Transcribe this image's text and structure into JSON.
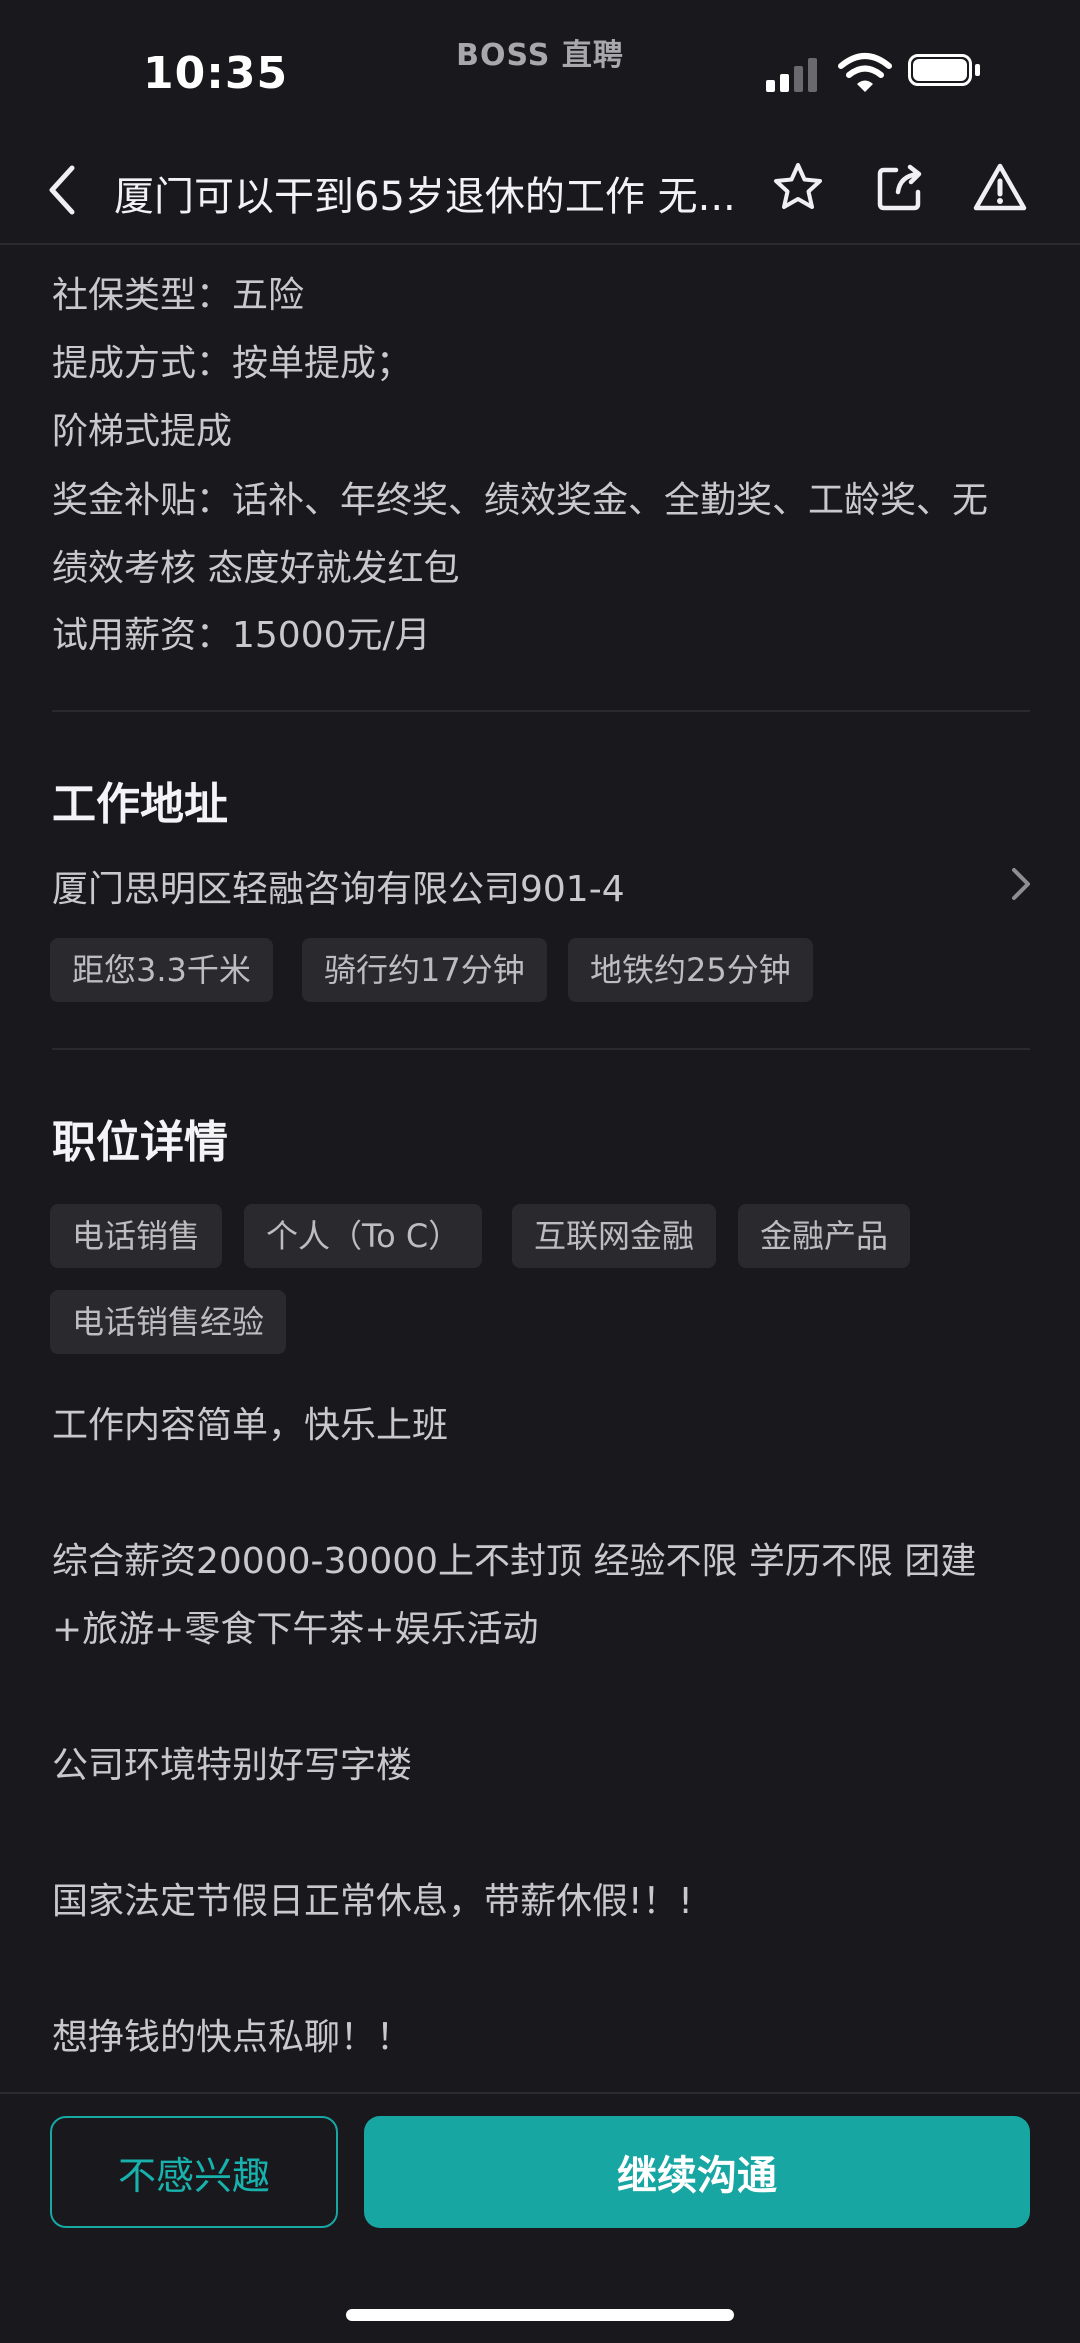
{
  "status_bar": {
    "time": "10:35",
    "carrier": "BOSS 直聘"
  },
  "header": {
    "title": "厦门可以干到65岁退休的工作 无...",
    "icons": [
      "back-icon",
      "star-icon",
      "share-icon",
      "report-icon"
    ]
  },
  "benefits": {
    "lines": [
      "社保类型：五险",
      "提成方式：按单提成；",
      "阶梯式提成",
      "奖金补贴：话补、年终奖、绩效奖金、全勤奖、工龄奖、无",
      "绩效考核 态度好就发红包",
      "试用薪资：15000元/月"
    ]
  },
  "address": {
    "title": "工作地址",
    "text": "厦门思明区轻融咨询有限公司901-4",
    "tags": [
      "距您3.3千米",
      "骑行约17分钟",
      "地铁约25分钟"
    ]
  },
  "details": {
    "title": "职位详情",
    "tags": [
      "电话销售",
      "个人（To C）",
      "互联网金融",
      "金融产品",
      "电话销售经验"
    ],
    "paragraphs": [
      "工作内容简单，快乐上班",
      "综合薪资20000-30000上不封顶 经验不限 学历不限 团建",
      "+旅游+零食下午茶+娱乐活动",
      "公司环境特别好写字楼",
      "国家法定节假日正常休息，带薪休假!！!",
      "想挣钱的快点私聊！！"
    ]
  },
  "actions": {
    "not_interested": "不感兴趣",
    "continue_chat": "继续沟通"
  },
  "colors": {
    "background": "#19181c",
    "accent": "#17a6a2",
    "tag_bg": "#2a292e"
  }
}
